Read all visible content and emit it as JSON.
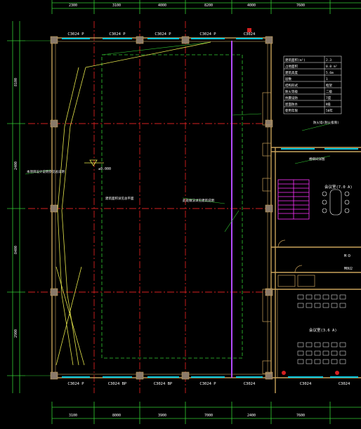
{
  "drawing": {
    "top_dims": [
      "2300",
      "3100",
      "4000",
      "8200",
      "4000",
      "7600"
    ],
    "bottom_dims": [
      "3100",
      "8000",
      "3900",
      "7000",
      "2400",
      "7600"
    ],
    "side_dims": [
      "8100",
      "2400",
      "8400",
      "2900"
    ],
    "windows_top": [
      "C3024 P",
      "C3024 P",
      "C3024 P",
      "C3024 P",
      "C3024"
    ],
    "windows_bottom": [
      "C3024 P",
      "C3024 BP",
      "C3024 BP",
      "C3024 P",
      "C3024",
      "C3024",
      "C3024"
    ],
    "room_labels": {
      "meeting_a": "会议室(7.0 A)",
      "meeting_b": "会议室(3.6 A)",
      "door_a": "M-D",
      "door_b": "M0U2"
    },
    "ann_elev": "±0.000",
    "ann_left": "本项目设计说明参见总说明",
    "ann_center": "建筑面积详见总平面",
    "ann_mid": "此处做法详见建筑说明",
    "ann_right_a": "防火墙(耐火极限)",
    "ann_right_b": "楼梯间详图"
  },
  "info_table": {
    "rows": [
      [
        "建筑面积(m²)",
        "2.3"
      ],
      [
        "占地面积",
        "0.0 m²"
      ],
      [
        "建筑高度",
        "5.6m"
      ],
      [
        "层数",
        "1"
      ],
      [
        "结构形式",
        "框架"
      ],
      [
        "耐火等级",
        "二级"
      ],
      [
        "抗震设防",
        "7度"
      ],
      [
        "屋面防水",
        "Ⅱ级"
      ],
      [
        "使用年限",
        "50年"
      ]
    ]
  },
  "colors": {
    "background": "#000000",
    "dimension": "#33cc33",
    "axis": "#d42020",
    "wall": "#c9a25a",
    "window": "#00c8e0",
    "annotation": "#e6e64c",
    "text": "#ffffff",
    "purple_wall": "#b44cff",
    "stair": "#ff33ff"
  }
}
